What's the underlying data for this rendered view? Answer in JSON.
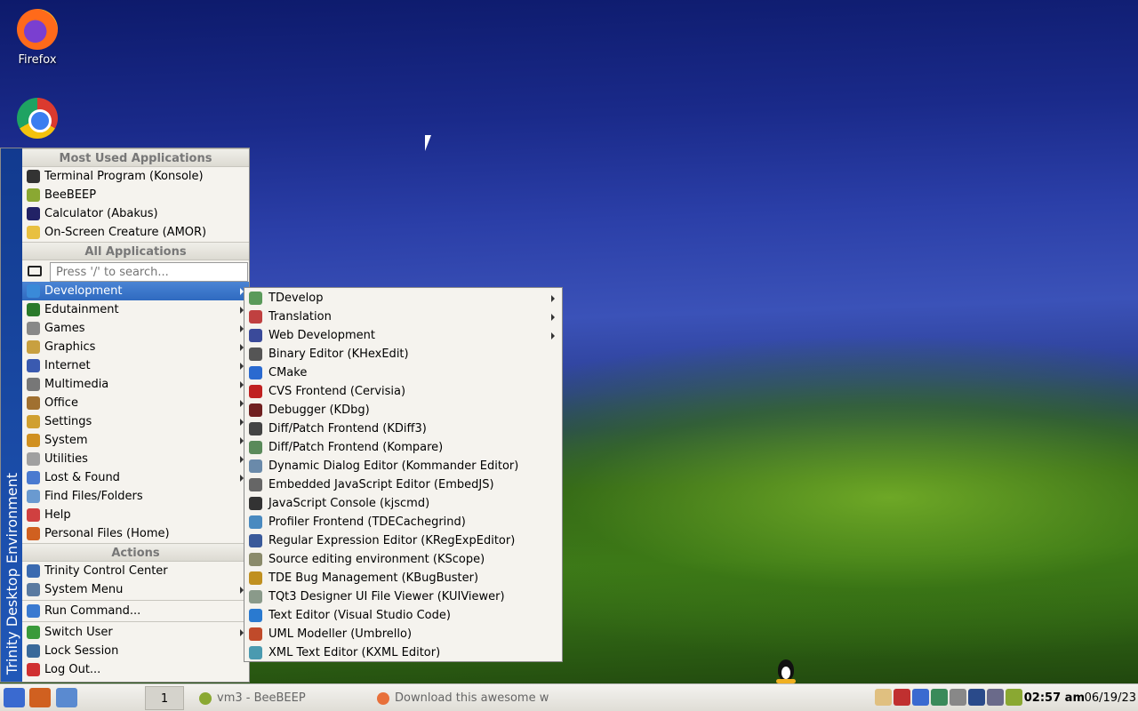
{
  "desktop": {
    "icons": [
      {
        "label": "Firefox"
      },
      {
        "label": ""
      }
    ]
  },
  "kmenu": {
    "side_label": "Trinity Desktop Environment",
    "most_used_header": "Most Used Applications",
    "most_used": [
      {
        "label": "Terminal Program (Konsole)",
        "icon": "terminal-icon",
        "color": "#333333"
      },
      {
        "label": "BeeBEEP",
        "icon": "bee-icon",
        "color": "#8aa832"
      },
      {
        "label": "Calculator (Abakus)",
        "icon": "calculator-icon",
        "color": "#222266"
      },
      {
        "label": "On-Screen Creature (AMOR)",
        "icon": "creature-icon",
        "color": "#e8c040"
      }
    ],
    "all_apps_header": "All Applications",
    "search_placeholder": "Press '/' to search...",
    "categories": [
      {
        "label": "Development",
        "icon": "development-icon",
        "color": "#3a8ad8",
        "submenu": true,
        "active": true
      },
      {
        "label": "Edutainment",
        "icon": "edutainment-icon",
        "color": "#2a7a2a",
        "submenu": true
      },
      {
        "label": "Games",
        "icon": "games-icon",
        "color": "#888888",
        "submenu": true
      },
      {
        "label": "Graphics",
        "icon": "graphics-icon",
        "color": "#c8a040",
        "submenu": true
      },
      {
        "label": "Internet",
        "icon": "internet-icon",
        "color": "#3a5ab0",
        "submenu": true
      },
      {
        "label": "Multimedia",
        "icon": "multimedia-icon",
        "color": "#777777",
        "submenu": true
      },
      {
        "label": "Office",
        "icon": "office-icon",
        "color": "#a07030",
        "submenu": true
      },
      {
        "label": "Settings",
        "icon": "settings-icon",
        "color": "#d0a030",
        "submenu": true
      },
      {
        "label": "System",
        "icon": "system-icon",
        "color": "#d09020",
        "submenu": true
      },
      {
        "label": "Utilities",
        "icon": "utilities-icon",
        "color": "#a0a0a0",
        "submenu": true
      },
      {
        "label": "Lost & Found",
        "icon": "lost-found-icon",
        "color": "#4a7ad0",
        "submenu": true
      },
      {
        "label": "Find Files/Folders",
        "icon": "find-icon",
        "color": "#6a9ad0",
        "submenu": false
      },
      {
        "label": "Help",
        "icon": "help-icon",
        "color": "#d04040",
        "submenu": false
      },
      {
        "label": "Personal Files (Home)",
        "icon": "home-icon",
        "color": "#d06020",
        "submenu": false
      }
    ],
    "actions_header": "Actions",
    "actions": [
      {
        "label": "Trinity Control Center",
        "icon": "control-center-icon",
        "color": "#3a6ab0",
        "submenu": false
      },
      {
        "label": "System Menu",
        "icon": "system-menu-icon",
        "color": "#5a7aa0",
        "submenu": true
      }
    ],
    "run_command": {
      "label": "Run Command...",
      "icon": "run-icon",
      "color": "#3a7ad0"
    },
    "session": [
      {
        "label": "Switch User",
        "icon": "switch-user-icon",
        "color": "#3a9a3a",
        "submenu": true
      },
      {
        "label": "Lock Session",
        "icon": "lock-icon",
        "color": "#3a6a9a",
        "submenu": false
      },
      {
        "label": "Log Out...",
        "icon": "logout-icon",
        "color": "#d03030",
        "submenu": false
      }
    ]
  },
  "development_submenu": [
    {
      "label": "TDevelop",
      "icon": "tdevelop-icon",
      "color": "#5a9a5a",
      "submenu": true
    },
    {
      "label": "Translation",
      "icon": "translation-icon",
      "color": "#c04040",
      "submenu": true
    },
    {
      "label": "Web Development",
      "icon": "web-dev-icon",
      "color": "#3a4a9a",
      "submenu": true
    },
    {
      "label": "Binary Editor (KHexEdit)",
      "icon": "hex-editor-icon",
      "color": "#555555",
      "submenu": false
    },
    {
      "label": "CMake",
      "icon": "cmake-icon",
      "color": "#2a6ad0",
      "submenu": false
    },
    {
      "label": "CVS Frontend (Cervisia)",
      "icon": "cervisia-icon",
      "color": "#c02020",
      "submenu": false
    },
    {
      "label": "Debugger (KDbg)",
      "icon": "debugger-icon",
      "color": "#702020",
      "submenu": false
    },
    {
      "label": "Diff/Patch Frontend (KDiff3)",
      "icon": "kdiff3-icon",
      "color": "#444444",
      "submenu": false
    },
    {
      "label": "Diff/Patch Frontend (Kompare)",
      "icon": "kompare-icon",
      "color": "#5a8a5a",
      "submenu": false
    },
    {
      "label": "Dynamic Dialog Editor (Kommander Editor)",
      "icon": "kommander-icon",
      "color": "#6a8aaa",
      "submenu": false
    },
    {
      "label": "Embedded JavaScript Editor (EmbedJS)",
      "icon": "embedjs-icon",
      "color": "#666666",
      "submenu": false
    },
    {
      "label": "JavaScript Console (kjscmd)",
      "icon": "console-icon",
      "color": "#333333",
      "submenu": false
    },
    {
      "label": "Profiler Frontend (TDECachegrind)",
      "icon": "profiler-icon",
      "color": "#4a8ac0",
      "submenu": false
    },
    {
      "label": "Regular Expression Editor (KRegExpEditor)",
      "icon": "regexp-icon",
      "color": "#3a5a9a",
      "submenu": false
    },
    {
      "label": "Source editing environment (KScope)",
      "icon": "kscope-icon",
      "color": "#8a8a6a",
      "submenu": false
    },
    {
      "label": "TDE Bug Management (KBugBuster)",
      "icon": "bugbuster-icon",
      "color": "#c09020",
      "submenu": false
    },
    {
      "label": "TQt3 Designer UI File Viewer (KUIViewer)",
      "icon": "kuiviewer-icon",
      "color": "#8a9a8a",
      "submenu": false
    },
    {
      "label": "Text Editor (Visual Studio Code)",
      "icon": "vscode-icon",
      "color": "#2a7ad0",
      "submenu": false
    },
    {
      "label": "UML Modeller (Umbrello)",
      "icon": "umbrello-icon",
      "color": "#c04a2a",
      "submenu": false
    },
    {
      "label": "XML Text Editor (KXML Editor)",
      "icon": "xml-editor-icon",
      "color": "#4a9ab0",
      "submenu": false
    }
  ],
  "taskbar": {
    "desktop_number": "1",
    "tasks": [
      {
        "label": "vm3 - BeeBEEP",
        "icon": "bee-icon",
        "color": "#8aa832"
      },
      {
        "label": "Download this awesome w",
        "icon": "firefox-icon",
        "color": "#e8703a"
      }
    ],
    "tray_icons": [
      {
        "icon": "kwallet-icon",
        "color": "#e0c080"
      },
      {
        "icon": "network-icon",
        "color": "#c03030"
      },
      {
        "icon": "klipper-icon",
        "color": "#3a6ad0"
      },
      {
        "icon": "monitor-icon",
        "color": "#3a8a5a"
      },
      {
        "icon": "volume-icon",
        "color": "#888888"
      },
      {
        "icon": "display-icon",
        "color": "#2a4a8a"
      },
      {
        "icon": "printer-icon",
        "color": "#6a6a8a"
      },
      {
        "icon": "beebeep-tray-icon",
        "color": "#8aa832"
      }
    ],
    "clock": "02:57 am",
    "date": "06/19/23"
  }
}
